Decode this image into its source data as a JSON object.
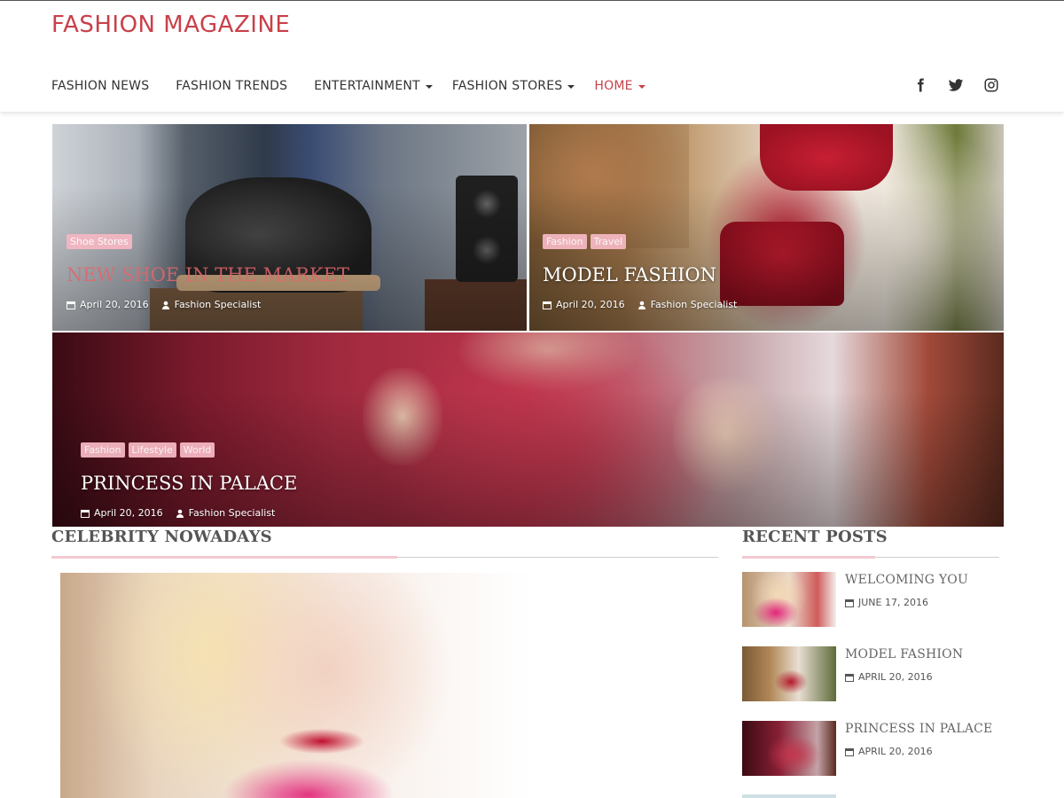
{
  "site": {
    "title": "FASHION MAGAZINE",
    "accent_color": "#c9404a"
  },
  "nav": {
    "items": [
      {
        "label": "FASHION NEWS",
        "has_dropdown": false,
        "active": false
      },
      {
        "label": "FASHION TRENDS",
        "has_dropdown": false,
        "active": false
      },
      {
        "label": "ENTERTAINMENT",
        "has_dropdown": true,
        "active": false
      },
      {
        "label": "FASHION STORES",
        "has_dropdown": true,
        "active": false
      },
      {
        "label": "HOME",
        "has_dropdown": true,
        "active": true
      }
    ]
  },
  "social": [
    "facebook-icon",
    "twitter-icon",
    "instagram-icon"
  ],
  "featured": [
    {
      "tags": [
        "Shoe Stores"
      ],
      "title": "NEW SHOE IN THE MARKET",
      "date": "April 20, 2016",
      "author": "Fashion Specialist"
    },
    {
      "tags": [
        "Fashion",
        "Travel"
      ],
      "title": "MODEL FASHION",
      "date": "April 20, 2016",
      "author": "Fashion Specialist"
    },
    {
      "tags": [
        "Fashion",
        "Lifestyle",
        "World"
      ],
      "title": "PRINCESS IN PALACE",
      "date": "April 20, 2016",
      "author": "Fashion Specialist"
    }
  ],
  "sections": {
    "main_title": "CELEBRITY NOWADAYS",
    "sidebar_title": "RECENT POSTS"
  },
  "recent_posts": [
    {
      "title": "WELCOMING YOU",
      "date": "JUNE 17, 2016"
    },
    {
      "title": "MODEL FASHION",
      "date": "APRIL 20, 2016"
    },
    {
      "title": "PRINCESS IN PALACE",
      "date": "APRIL 20, 2016"
    }
  ],
  "colors": {
    "tag_bg": "#f4b7c2",
    "section_accent": "#f3c9d0"
  }
}
